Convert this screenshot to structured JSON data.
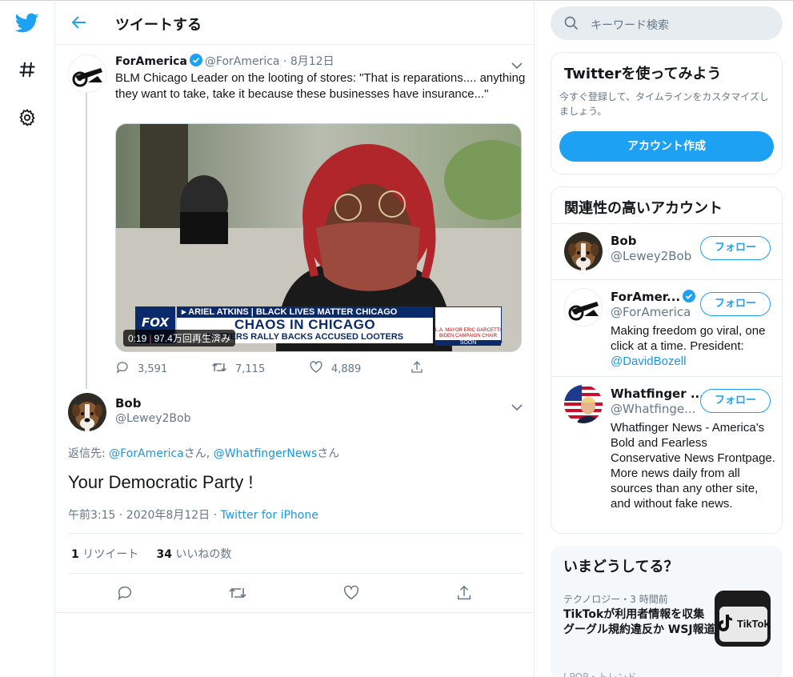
{
  "nav": {
    "logo_icon": "twitter-bird-icon",
    "explore_icon": "hashtag-icon",
    "settings_icon": "gear-icon",
    "accent": "#1da1f2"
  },
  "header": {
    "title": "ツイートする"
  },
  "tweet1": {
    "name": "ForAmerica",
    "handle": "@ForAmerica",
    "date": "· 8月12日",
    "text": "BLM Chicago Leader on the looting of stores: \"That is reparations.... anything they want to take, take it because these businesses have insurance...\"",
    "video": {
      "duration": "0:19",
      "views": "97.4万回再生済み",
      "chyron_top": "▸ ARIEL ATKINS | BLACK LIVES MATTER CHICAGO",
      "chyron_main": "CHAOS IN CHICAGO",
      "chyron_sub": "MATTERS RALLY BACKS ACCUSED LOOTERS",
      "network": "FOX",
      "side_box": "L.A. MAYOR ERIC GARCETTI BIDEN CAMPAIGN CHAIR",
      "side_soon": "SOON"
    },
    "replies": "3,591",
    "retweets": "7,115",
    "likes": "4,889"
  },
  "tweet2": {
    "name": "Bob",
    "handle": "@Lewey2Bob",
    "reply_prefix": "返信先: ",
    "reply_user1": "@ForAmerica",
    "reply_san1": "さん, ",
    "reply_user2": "@WhatfingerNews",
    "reply_san2": "さん",
    "text": "Your Democratic Party !",
    "time": "午前3:15 · 2020年8月12日 · ",
    "source": "Twitter for iPhone",
    "retweet_count": "1",
    "retweet_label": "リツイート",
    "like_count": "34",
    "like_label": "いいねの数"
  },
  "search": {
    "placeholder": "キーワード検索"
  },
  "signup_card": {
    "title": "Twitterを使ってみよう",
    "desc": "今すぐ登録して、タイムラインをカスタマイズしましょう。",
    "button": "アカウント作成"
  },
  "related": {
    "title": "関連性の高いアカウント",
    "follow_label": "フォロー",
    "accounts": [
      {
        "name": "Bob",
        "handle": "@Lewey2Bob",
        "bio": ""
      },
      {
        "name": "ForAmer...",
        "handle": "@ForAmerica",
        "bio": "Making freedom go viral, one click at a time. President: ",
        "bio_link": "@DavidBozell"
      },
      {
        "name": "Whatfinger ...",
        "handle": "@Whatfinge...",
        "bio": "Whatfinger News - America's Bold and Fearless Conservative News Frontpage. More news daily from all sources than any other site, and without fake news."
      }
    ]
  },
  "trends": {
    "title": "いまどうしてる？",
    "item_category": "テクノロジー・3 時間前",
    "item_title": "TikTokが利用者情報を収集 グーグル規約違反か WSJ報道",
    "item_image_text": "TikTok",
    "next_partial": "J-POP・トレンド"
  }
}
